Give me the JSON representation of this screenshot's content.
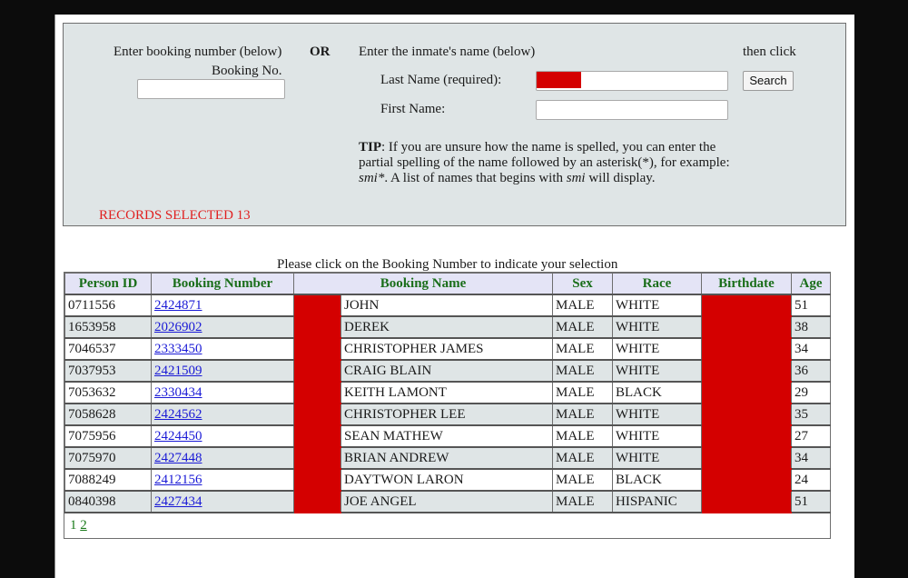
{
  "search": {
    "booking_prompt": "Enter booking number (below)",
    "booking_label": "Booking No.",
    "booking_value": "",
    "or_label": "OR",
    "name_prompt": "Enter the inmate's name (below)",
    "then_click": "then click",
    "last_name_label": "Last Name (required):",
    "last_name_value": "",
    "first_name_label": "First Name:",
    "first_name_value": "",
    "search_button": "Search",
    "tip_label": "TIP",
    "tip_text_1": ": If you are unsure how the name is spelled, you can enter the partial spelling of the name followed by an asterisk(*), for example: ",
    "tip_example": "smi*",
    "tip_text_2": ". A list of names that begins with ",
    "tip_example_2": "smi",
    "tip_text_3": " will display.",
    "records_selected": "RECORDS SELECTED 13"
  },
  "results": {
    "instruction": "Please click on the Booking Number to indicate your selection",
    "headers": [
      "Person ID",
      "Booking Number",
      "Booking Name",
      "Sex",
      "Race",
      "Birthdate",
      "Age"
    ],
    "rows": [
      {
        "person_id": "0711556",
        "booking_number": "2424871",
        "first_names": "JOHN",
        "sex": "MALE",
        "race": "WHITE",
        "age": "51"
      },
      {
        "person_id": "1653958",
        "booking_number": "2026902",
        "first_names": "DEREK",
        "sex": "MALE",
        "race": "WHITE",
        "age": "38"
      },
      {
        "person_id": "7046537",
        "booking_number": "2333450",
        "first_names": "CHRISTOPHER JAMES",
        "sex": "MALE",
        "race": "WHITE",
        "age": "34"
      },
      {
        "person_id": "7037953",
        "booking_number": "2421509",
        "first_names": "CRAIG BLAIN",
        "sex": "MALE",
        "race": "WHITE",
        "age": "36"
      },
      {
        "person_id": "7053632",
        "booking_number": "2330434",
        "first_names": "KEITH LAMONT",
        "sex": "MALE",
        "race": "BLACK",
        "age": "29"
      },
      {
        "person_id": "7058628",
        "booking_number": "2424562",
        "first_names": "CHRISTOPHER LEE",
        "sex": "MALE",
        "race": "WHITE",
        "age": "35"
      },
      {
        "person_id": "7075956",
        "booking_number": "2424450",
        "first_names": "SEAN MATHEW",
        "sex": "MALE",
        "race": "WHITE",
        "age": "27"
      },
      {
        "person_id": "7075970",
        "booking_number": "2427448",
        "first_names": "BRIAN ANDREW",
        "sex": "MALE",
        "race": "WHITE",
        "age": "34"
      },
      {
        "person_id": "7088249",
        "booking_number": "2412156",
        "first_names": "DAYTWON LARON",
        "sex": "MALE",
        "race": "BLACK",
        "age": "24"
      },
      {
        "person_id": "0840398",
        "booking_number": "2427434",
        "first_names": "JOE ANGEL",
        "sex": "MALE",
        "race": "HISPANIC",
        "age": "51"
      }
    ],
    "pager": {
      "current": "1",
      "pages": [
        "2"
      ]
    }
  },
  "colors": {
    "redaction": "#d40000",
    "header_text": "#1a6e1a",
    "records_text": "#e02020",
    "link": "#1a1ad6"
  }
}
